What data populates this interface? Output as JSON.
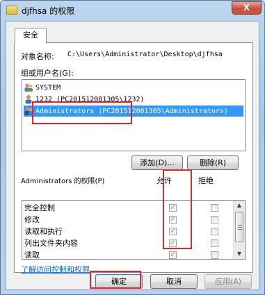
{
  "window": {
    "title": "djfhsa 的权限",
    "close_label": "X"
  },
  "tab": {
    "label": "安全"
  },
  "object": {
    "label": "对象名称:",
    "value": "C:\\Users\\Administrator\\Desktop\\djfhsa"
  },
  "groups": {
    "label": "组或用户名(G):",
    "items": [
      {
        "name": "SYSTEM"
      },
      {
        "name": "1232 (PC201512081305\\1232)"
      },
      {
        "name": "Administrators (PC201512081305\\Administrators)"
      }
    ],
    "add_button": "添加(D)...",
    "remove_button": "删除(R)"
  },
  "permissions": {
    "label": "Administrators 的权限(P)",
    "allow_header": "允许",
    "deny_header": "拒绝",
    "rows": [
      {
        "name": "完全控制",
        "allow": true,
        "deny": false
      },
      {
        "name": "修改",
        "allow": true,
        "deny": false
      },
      {
        "name": "读取和执行",
        "allow": true,
        "deny": false
      },
      {
        "name": "列出文件夹内容",
        "allow": true,
        "deny": false
      },
      {
        "name": "读取",
        "allow": true,
        "deny": false
      }
    ]
  },
  "link": {
    "label": "了解访问控制和权限"
  },
  "footer": {
    "ok": "确定",
    "cancel": "取消",
    "apply": "应用(A)"
  },
  "colors": {
    "selection": "#3399ff",
    "highlight": "#e2262b",
    "link": "#0066cc"
  }
}
